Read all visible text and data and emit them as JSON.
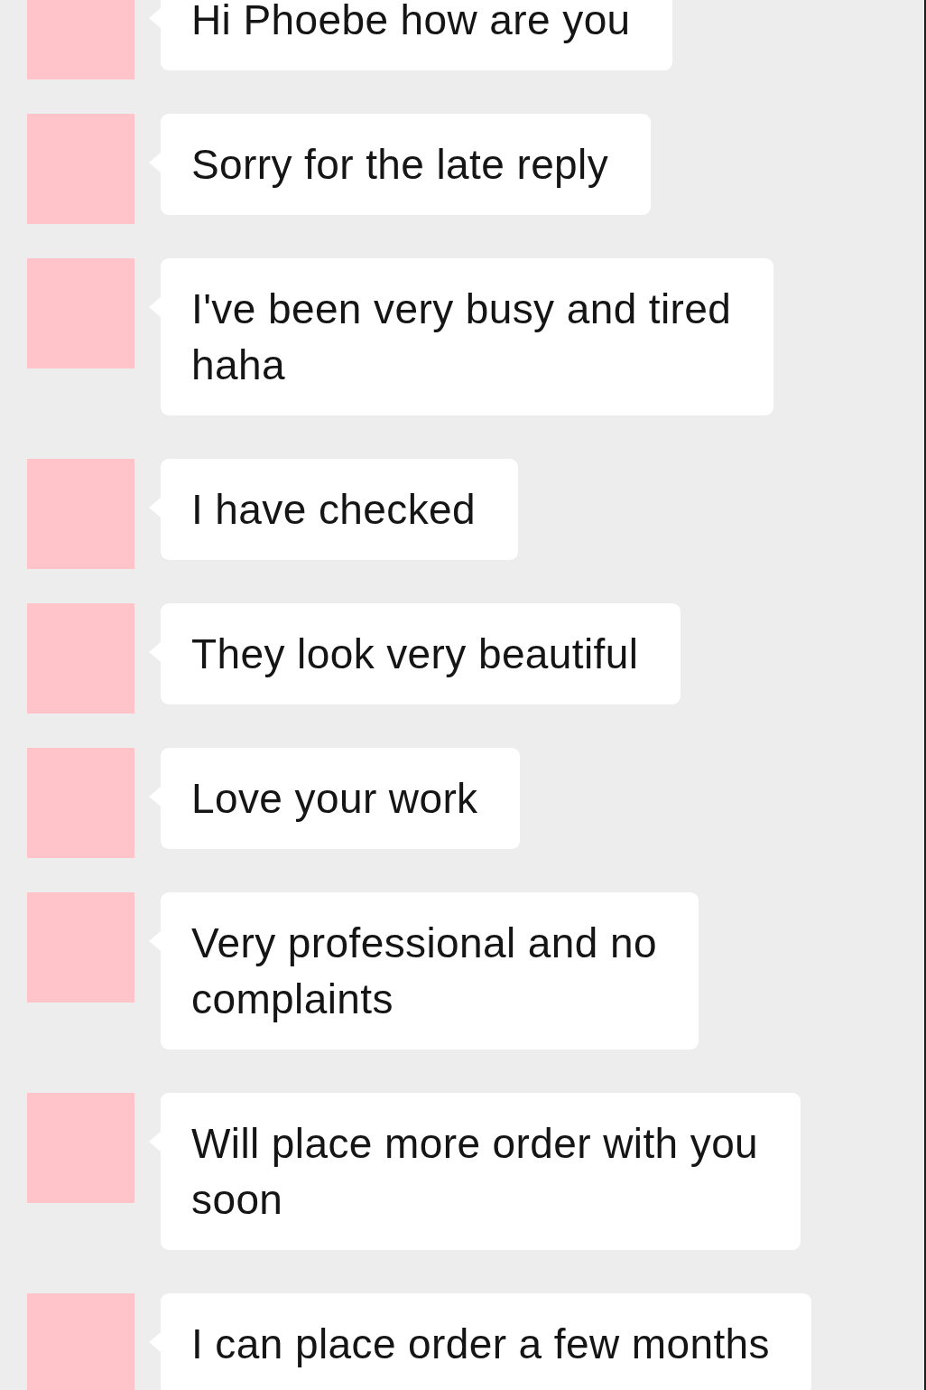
{
  "messages": [
    {
      "text": "Hi Phoebe how are you"
    },
    {
      "text": "Sorry for the late reply"
    },
    {
      "text": "I've been very busy and tired haha"
    },
    {
      "text": "I have checked"
    },
    {
      "text": "They look very beautiful"
    },
    {
      "text": "Love your work"
    },
    {
      "text": "Very professional and no complaints"
    },
    {
      "text": "Will place more order with you soon"
    },
    {
      "text": "I can place order a few months"
    }
  ]
}
